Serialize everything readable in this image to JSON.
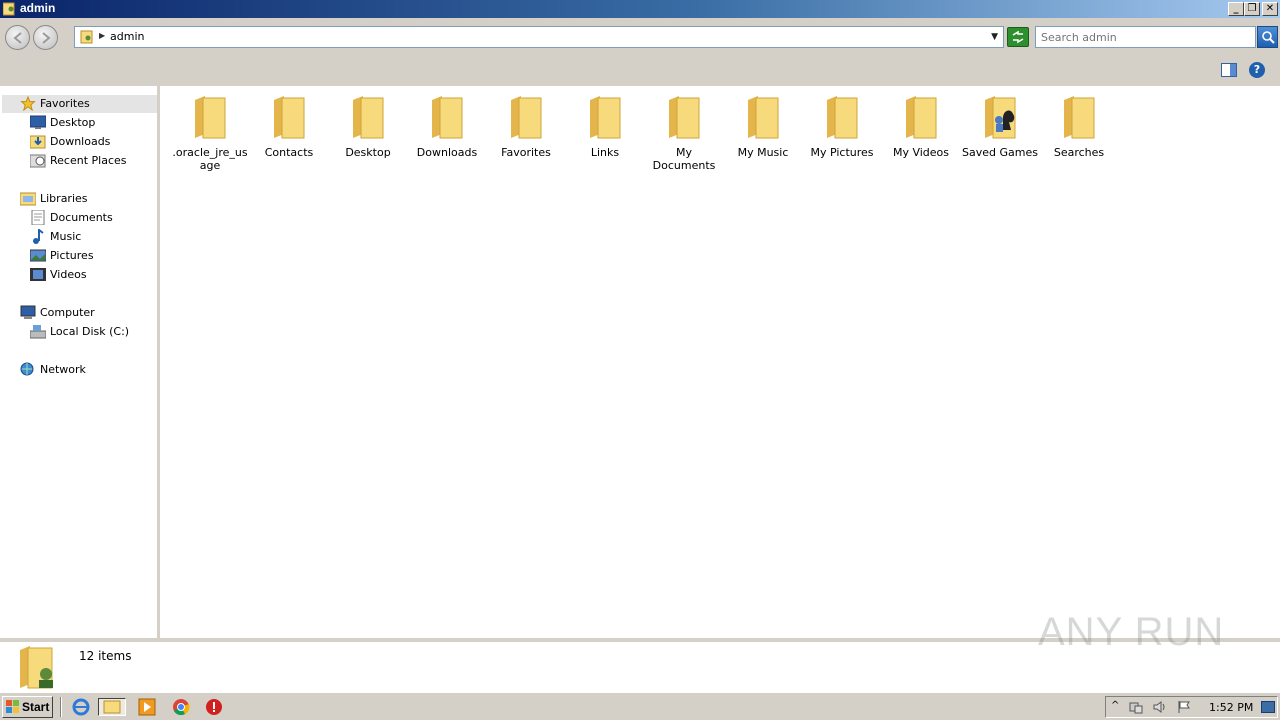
{
  "window": {
    "title": "admin",
    "minimize_icon": "minimize-icon",
    "restore_icon": "restore-icon",
    "close_icon": "close-icon"
  },
  "address_bar": {
    "path": "admin",
    "search_placeholder": "Search admin"
  },
  "nav_pane": {
    "favorites": {
      "label": "Favorites",
      "items": [
        {
          "label": "Desktop",
          "icon": "desktop-icon"
        },
        {
          "label": "Downloads",
          "icon": "downloads-icon"
        },
        {
          "label": "Recent Places",
          "icon": "recent-places-icon"
        }
      ]
    },
    "libraries": {
      "label": "Libraries",
      "items": [
        {
          "label": "Documents",
          "icon": "documents-icon"
        },
        {
          "label": "Music",
          "icon": "music-icon"
        },
        {
          "label": "Pictures",
          "icon": "pictures-icon"
        },
        {
          "label": "Videos",
          "icon": "videos-icon"
        }
      ]
    },
    "computer": {
      "label": "Computer",
      "items": [
        {
          "label": "Local Disk (C:)",
          "icon": "local-disk-icon"
        }
      ]
    },
    "network": {
      "label": "Network"
    }
  },
  "files": [
    {
      "name": ".oracle_jre_usage"
    },
    {
      "name": "Contacts"
    },
    {
      "name": "Desktop"
    },
    {
      "name": "Downloads"
    },
    {
      "name": "Favorites"
    },
    {
      "name": "Links"
    },
    {
      "name": "My Documents"
    },
    {
      "name": "My Music"
    },
    {
      "name": "My Pictures"
    },
    {
      "name": "My Videos"
    },
    {
      "name": "Saved Games"
    },
    {
      "name": "Searches"
    }
  ],
  "details": {
    "item_count": "12 items"
  },
  "taskbar": {
    "start_label": "Start",
    "clock": "1:52 PM"
  },
  "watermark": "ANY RUN",
  "colors": {
    "folder_fill": "#f6da7c",
    "folder_dark": "#e3b54a",
    "chrome": "#d4d0c8",
    "title_blue": "#0a246a"
  }
}
